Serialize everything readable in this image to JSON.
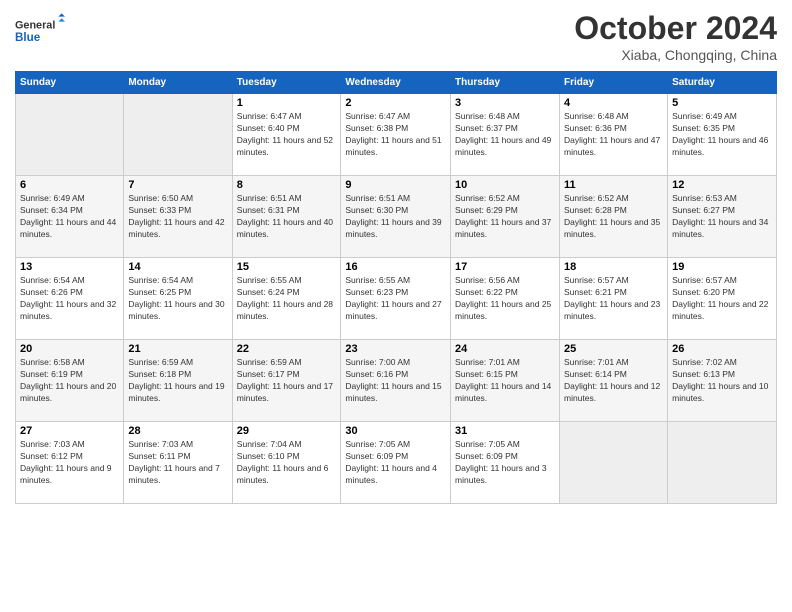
{
  "header": {
    "logo_line1": "General",
    "logo_line2": "Blue",
    "main_title": "October 2024",
    "subtitle": "Xiaba, Chongqing, China"
  },
  "weekdays": [
    "Sunday",
    "Monday",
    "Tuesday",
    "Wednesday",
    "Thursday",
    "Friday",
    "Saturday"
  ],
  "weeks": [
    [
      {
        "day": "",
        "sunrise": "",
        "sunset": "",
        "daylight": "",
        "empty": true
      },
      {
        "day": "",
        "sunrise": "",
        "sunset": "",
        "daylight": "",
        "empty": true
      },
      {
        "day": "1",
        "sunrise": "Sunrise: 6:47 AM",
        "sunset": "Sunset: 6:40 PM",
        "daylight": "Daylight: 11 hours and 52 minutes.",
        "empty": false
      },
      {
        "day": "2",
        "sunrise": "Sunrise: 6:47 AM",
        "sunset": "Sunset: 6:38 PM",
        "daylight": "Daylight: 11 hours and 51 minutes.",
        "empty": false
      },
      {
        "day": "3",
        "sunrise": "Sunrise: 6:48 AM",
        "sunset": "Sunset: 6:37 PM",
        "daylight": "Daylight: 11 hours and 49 minutes.",
        "empty": false
      },
      {
        "day": "4",
        "sunrise": "Sunrise: 6:48 AM",
        "sunset": "Sunset: 6:36 PM",
        "daylight": "Daylight: 11 hours and 47 minutes.",
        "empty": false
      },
      {
        "day": "5",
        "sunrise": "Sunrise: 6:49 AM",
        "sunset": "Sunset: 6:35 PM",
        "daylight": "Daylight: 11 hours and 46 minutes.",
        "empty": false
      }
    ],
    [
      {
        "day": "6",
        "sunrise": "Sunrise: 6:49 AM",
        "sunset": "Sunset: 6:34 PM",
        "daylight": "Daylight: 11 hours and 44 minutes.",
        "empty": false
      },
      {
        "day": "7",
        "sunrise": "Sunrise: 6:50 AM",
        "sunset": "Sunset: 6:33 PM",
        "daylight": "Daylight: 11 hours and 42 minutes.",
        "empty": false
      },
      {
        "day": "8",
        "sunrise": "Sunrise: 6:51 AM",
        "sunset": "Sunset: 6:31 PM",
        "daylight": "Daylight: 11 hours and 40 minutes.",
        "empty": false
      },
      {
        "day": "9",
        "sunrise": "Sunrise: 6:51 AM",
        "sunset": "Sunset: 6:30 PM",
        "daylight": "Daylight: 11 hours and 39 minutes.",
        "empty": false
      },
      {
        "day": "10",
        "sunrise": "Sunrise: 6:52 AM",
        "sunset": "Sunset: 6:29 PM",
        "daylight": "Daylight: 11 hours and 37 minutes.",
        "empty": false
      },
      {
        "day": "11",
        "sunrise": "Sunrise: 6:52 AM",
        "sunset": "Sunset: 6:28 PM",
        "daylight": "Daylight: 11 hours and 35 minutes.",
        "empty": false
      },
      {
        "day": "12",
        "sunrise": "Sunrise: 6:53 AM",
        "sunset": "Sunset: 6:27 PM",
        "daylight": "Daylight: 11 hours and 34 minutes.",
        "empty": false
      }
    ],
    [
      {
        "day": "13",
        "sunrise": "Sunrise: 6:54 AM",
        "sunset": "Sunset: 6:26 PM",
        "daylight": "Daylight: 11 hours and 32 minutes.",
        "empty": false
      },
      {
        "day": "14",
        "sunrise": "Sunrise: 6:54 AM",
        "sunset": "Sunset: 6:25 PM",
        "daylight": "Daylight: 11 hours and 30 minutes.",
        "empty": false
      },
      {
        "day": "15",
        "sunrise": "Sunrise: 6:55 AM",
        "sunset": "Sunset: 6:24 PM",
        "daylight": "Daylight: 11 hours and 28 minutes.",
        "empty": false
      },
      {
        "day": "16",
        "sunrise": "Sunrise: 6:55 AM",
        "sunset": "Sunset: 6:23 PM",
        "daylight": "Daylight: 11 hours and 27 minutes.",
        "empty": false
      },
      {
        "day": "17",
        "sunrise": "Sunrise: 6:56 AM",
        "sunset": "Sunset: 6:22 PM",
        "daylight": "Daylight: 11 hours and 25 minutes.",
        "empty": false
      },
      {
        "day": "18",
        "sunrise": "Sunrise: 6:57 AM",
        "sunset": "Sunset: 6:21 PM",
        "daylight": "Daylight: 11 hours and 23 minutes.",
        "empty": false
      },
      {
        "day": "19",
        "sunrise": "Sunrise: 6:57 AM",
        "sunset": "Sunset: 6:20 PM",
        "daylight": "Daylight: 11 hours and 22 minutes.",
        "empty": false
      }
    ],
    [
      {
        "day": "20",
        "sunrise": "Sunrise: 6:58 AM",
        "sunset": "Sunset: 6:19 PM",
        "daylight": "Daylight: 11 hours and 20 minutes.",
        "empty": false
      },
      {
        "day": "21",
        "sunrise": "Sunrise: 6:59 AM",
        "sunset": "Sunset: 6:18 PM",
        "daylight": "Daylight: 11 hours and 19 minutes.",
        "empty": false
      },
      {
        "day": "22",
        "sunrise": "Sunrise: 6:59 AM",
        "sunset": "Sunset: 6:17 PM",
        "daylight": "Daylight: 11 hours and 17 minutes.",
        "empty": false
      },
      {
        "day": "23",
        "sunrise": "Sunrise: 7:00 AM",
        "sunset": "Sunset: 6:16 PM",
        "daylight": "Daylight: 11 hours and 15 minutes.",
        "empty": false
      },
      {
        "day": "24",
        "sunrise": "Sunrise: 7:01 AM",
        "sunset": "Sunset: 6:15 PM",
        "daylight": "Daylight: 11 hours and 14 minutes.",
        "empty": false
      },
      {
        "day": "25",
        "sunrise": "Sunrise: 7:01 AM",
        "sunset": "Sunset: 6:14 PM",
        "daylight": "Daylight: 11 hours and 12 minutes.",
        "empty": false
      },
      {
        "day": "26",
        "sunrise": "Sunrise: 7:02 AM",
        "sunset": "Sunset: 6:13 PM",
        "daylight": "Daylight: 11 hours and 10 minutes.",
        "empty": false
      }
    ],
    [
      {
        "day": "27",
        "sunrise": "Sunrise: 7:03 AM",
        "sunset": "Sunset: 6:12 PM",
        "daylight": "Daylight: 11 hours and 9 minutes.",
        "empty": false
      },
      {
        "day": "28",
        "sunrise": "Sunrise: 7:03 AM",
        "sunset": "Sunset: 6:11 PM",
        "daylight": "Daylight: 11 hours and 7 minutes.",
        "empty": false
      },
      {
        "day": "29",
        "sunrise": "Sunrise: 7:04 AM",
        "sunset": "Sunset: 6:10 PM",
        "daylight": "Daylight: 11 hours and 6 minutes.",
        "empty": false
      },
      {
        "day": "30",
        "sunrise": "Sunrise: 7:05 AM",
        "sunset": "Sunset: 6:09 PM",
        "daylight": "Daylight: 11 hours and 4 minutes.",
        "empty": false
      },
      {
        "day": "31",
        "sunrise": "Sunrise: 7:05 AM",
        "sunset": "Sunset: 6:09 PM",
        "daylight": "Daylight: 11 hours and 3 minutes.",
        "empty": false
      },
      {
        "day": "",
        "sunrise": "",
        "sunset": "",
        "daylight": "",
        "empty": true
      },
      {
        "day": "",
        "sunrise": "",
        "sunset": "",
        "daylight": "",
        "empty": true
      }
    ]
  ]
}
